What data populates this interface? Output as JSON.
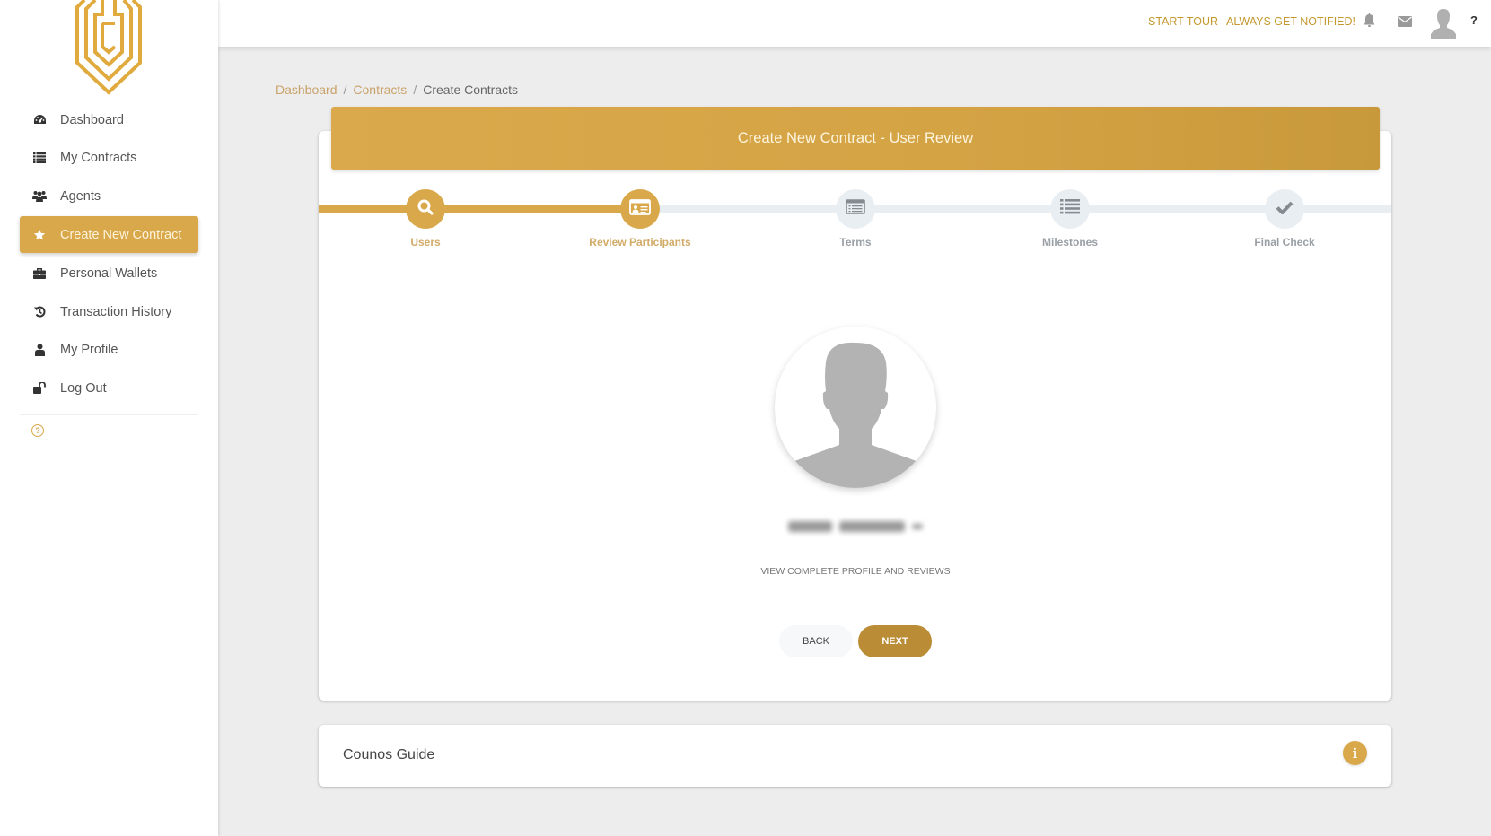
{
  "brand": {
    "accent": "#d9a84a",
    "accent_dark": "#b98c35",
    "logo": "counos-shield-logo"
  },
  "sidebar": {
    "items": [
      {
        "label": "Dashboard",
        "icon": "dashboard-gauge-icon",
        "active": false
      },
      {
        "label": "My Contracts",
        "icon": "list-icon",
        "active": false
      },
      {
        "label": "Agents",
        "icon": "users-group-icon",
        "active": false
      },
      {
        "label": "Create New Contract",
        "icon": "star-icon",
        "active": true
      },
      {
        "label": "Personal Wallets",
        "icon": "briefcase-icon",
        "active": false
      },
      {
        "label": "Transaction History",
        "icon": "history-icon",
        "active": false
      },
      {
        "label": "My Profile",
        "icon": "user-icon",
        "active": false
      },
      {
        "label": "Log Out",
        "icon": "unlock-icon",
        "active": false
      }
    ],
    "help_icon": "?"
  },
  "topbar": {
    "start_tour": "START TOUR",
    "always_notified": "ALWAYS GET NOTIFIED!",
    "help": "?"
  },
  "breadcrumb": {
    "items": [
      "Dashboard",
      "Contracts",
      "Create Contracts"
    ],
    "separator": "/"
  },
  "card": {
    "title": "Create New Contract - User Review",
    "steps": [
      {
        "label": "Users",
        "icon": "search-icon",
        "done": true
      },
      {
        "label": "Review Participants",
        "icon": "id-card-icon",
        "done": true
      },
      {
        "label": "Terms",
        "icon": "form-icon",
        "done": false
      },
      {
        "label": "Milestones",
        "icon": "list-icon",
        "done": false
      },
      {
        "label": "Final Check",
        "icon": "check-icon",
        "done": false
      }
    ],
    "profile": {
      "name": "[redacted]",
      "view_link": "VIEW COMPLETE PROFILE AND REVIEWS"
    },
    "back_label": "BACK",
    "next_label": "NEXT"
  },
  "guide": {
    "title": "Counos Guide",
    "info_icon": "i"
  }
}
